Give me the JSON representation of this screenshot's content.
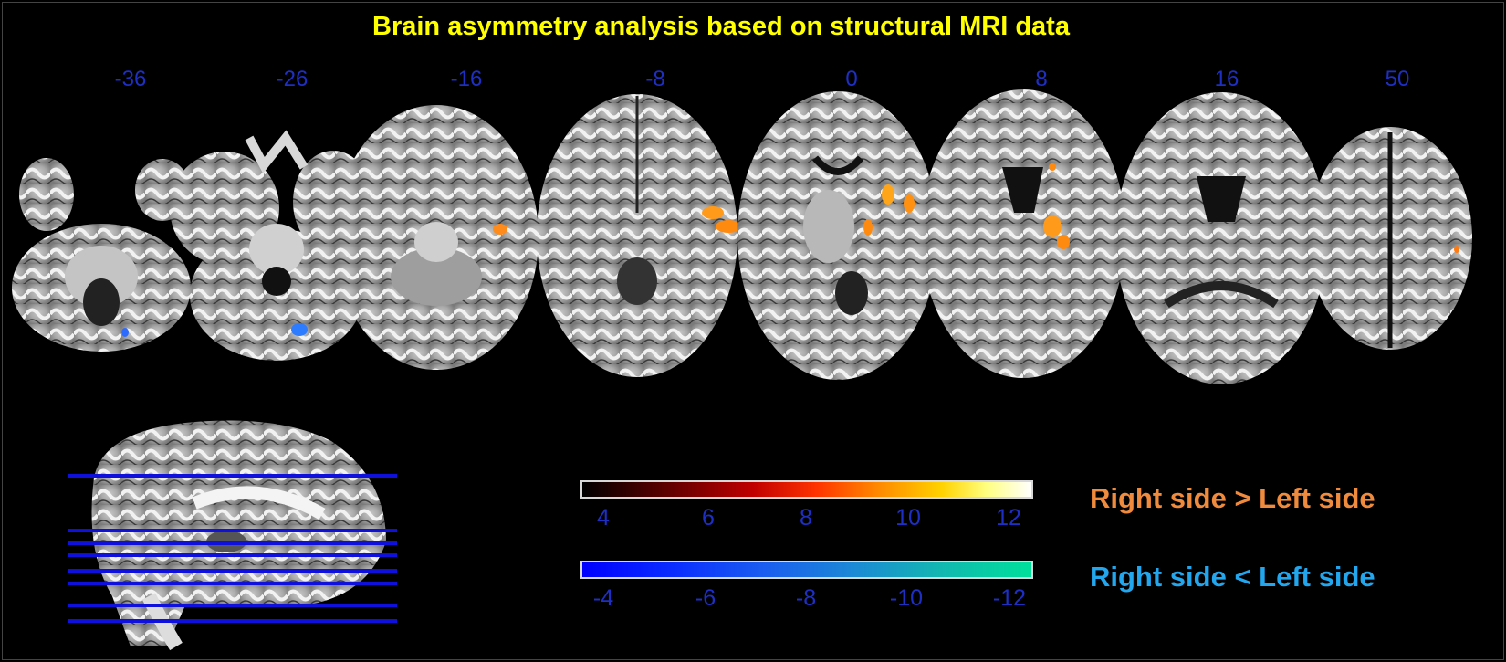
{
  "title": "Brain asymmetry analysis based on structural MRI data",
  "slice_labels": [
    "-36",
    "-26",
    "-16",
    "-8",
    "0",
    "8",
    "16",
    "50"
  ],
  "colorbar_positive": {
    "ticks": [
      "4",
      "6",
      "8",
      "10",
      "12"
    ],
    "label": "Right side > Left side",
    "label_color": "#f08a3c"
  },
  "colorbar_negative": {
    "ticks": [
      "-4",
      "-6",
      "-8",
      "-10",
      "-12"
    ],
    "label": "Right side < Left side",
    "label_color": "#22a6ee"
  },
  "colors": {
    "title": "#ffff00",
    "slice_label": "#1e2fc4",
    "slice_lines": "#1010dd"
  }
}
